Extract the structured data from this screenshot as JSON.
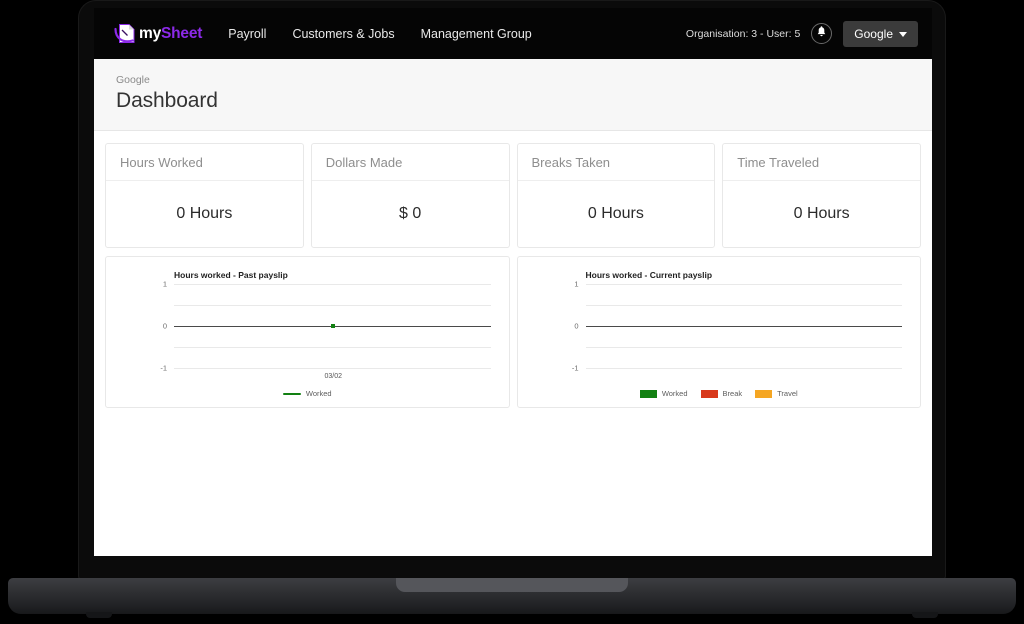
{
  "navbar": {
    "brand": {
      "part1": "my",
      "part2": "Sheet",
      "logo_icon": "document-swoosh-logo-icon"
    },
    "links": [
      {
        "label": "Payroll"
      },
      {
        "label": "Customers & Jobs"
      },
      {
        "label": "Management Group"
      }
    ],
    "org_info": "Organisation: 3 - User: 5",
    "notification_icon": "bell-icon",
    "account_label": "Google",
    "account_chevron_icon": "chevron-down-icon"
  },
  "header": {
    "breadcrumb": "Google",
    "title": "Dashboard"
  },
  "stats": [
    {
      "title": "Hours Worked",
      "value": "0 Hours"
    },
    {
      "title": "Dollars Made",
      "value": "$ 0"
    },
    {
      "title": "Breaks Taken",
      "value": "0 Hours"
    },
    {
      "title": "Time Traveled",
      "value": "0 Hours"
    }
  ],
  "colors": {
    "worked": "#128012",
    "break": "#d8391b",
    "travel": "#f5a623",
    "brand_purple": "#8c2ae8",
    "accent_dark": "#3b3b3b"
  },
  "chart_data": [
    {
      "type": "scatter",
      "title": "Hours worked - Past payslip",
      "xlabel": "",
      "ylabel": "",
      "x": [
        "03/02"
      ],
      "series": [
        {
          "name": "Worked",
          "color": "#128012",
          "values": [
            0
          ]
        }
      ],
      "ylim": [
        -1,
        1
      ],
      "yticks": [
        1,
        0,
        -1
      ],
      "ytick_labels": [
        "1",
        "0",
        "-1"
      ],
      "gridlines": [
        1,
        0.5,
        0,
        -0.5,
        -1
      ],
      "grid": true,
      "legend_position": "bottom",
      "legend": [
        {
          "label": "Worked",
          "color": "#128012",
          "marker": "line"
        }
      ]
    },
    {
      "type": "bar",
      "title": "Hours worked - Current payslip",
      "xlabel": "",
      "ylabel": "",
      "categories": [],
      "series": [
        {
          "name": "Worked",
          "color": "#128012",
          "values": []
        },
        {
          "name": "Break",
          "color": "#d8391b",
          "values": []
        },
        {
          "name": "Travel",
          "color": "#f5a623",
          "values": []
        }
      ],
      "ylim": [
        -1,
        1
      ],
      "yticks": [
        1,
        0,
        -1
      ],
      "ytick_labels": [
        "1",
        "0",
        "-1"
      ],
      "gridlines": [
        1,
        0.5,
        0,
        -0.5,
        -1
      ],
      "grid": true,
      "legend_position": "bottom",
      "legend": [
        {
          "label": "Worked",
          "color": "#128012",
          "marker": "box"
        },
        {
          "label": "Break",
          "color": "#d8391b",
          "marker": "box"
        },
        {
          "label": "Travel",
          "color": "#f5a623",
          "marker": "box"
        }
      ]
    }
  ]
}
